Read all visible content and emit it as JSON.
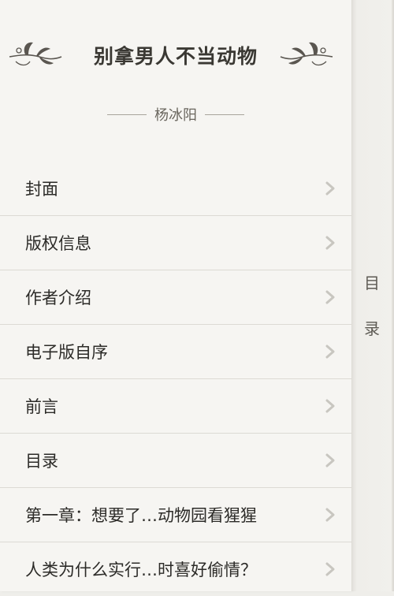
{
  "book": {
    "title": "别拿男人不当动物",
    "author": "杨冰阳"
  },
  "toc": {
    "items": [
      {
        "label": "封面"
      },
      {
        "label": "版权信息"
      },
      {
        "label": "作者介绍"
      },
      {
        "label": "电子版自序"
      },
      {
        "label": "前言"
      },
      {
        "label": "目录"
      },
      {
        "label": "第一章：想要了…动物园看猩猩"
      },
      {
        "label": "人类为什么实行…时喜好偷情？"
      }
    ]
  },
  "side_tab": {
    "chars": [
      "目",
      "录"
    ]
  },
  "icons": {
    "row_arrow": "chevron-right-icon",
    "ornament": "floral-ornament-icon"
  },
  "colors": {
    "page_background": "#f6f5f2",
    "title_text": "#3a3833",
    "item_text": "#2c2b28",
    "divider": "#dcdad4",
    "chevron": "#c8c6c0"
  }
}
